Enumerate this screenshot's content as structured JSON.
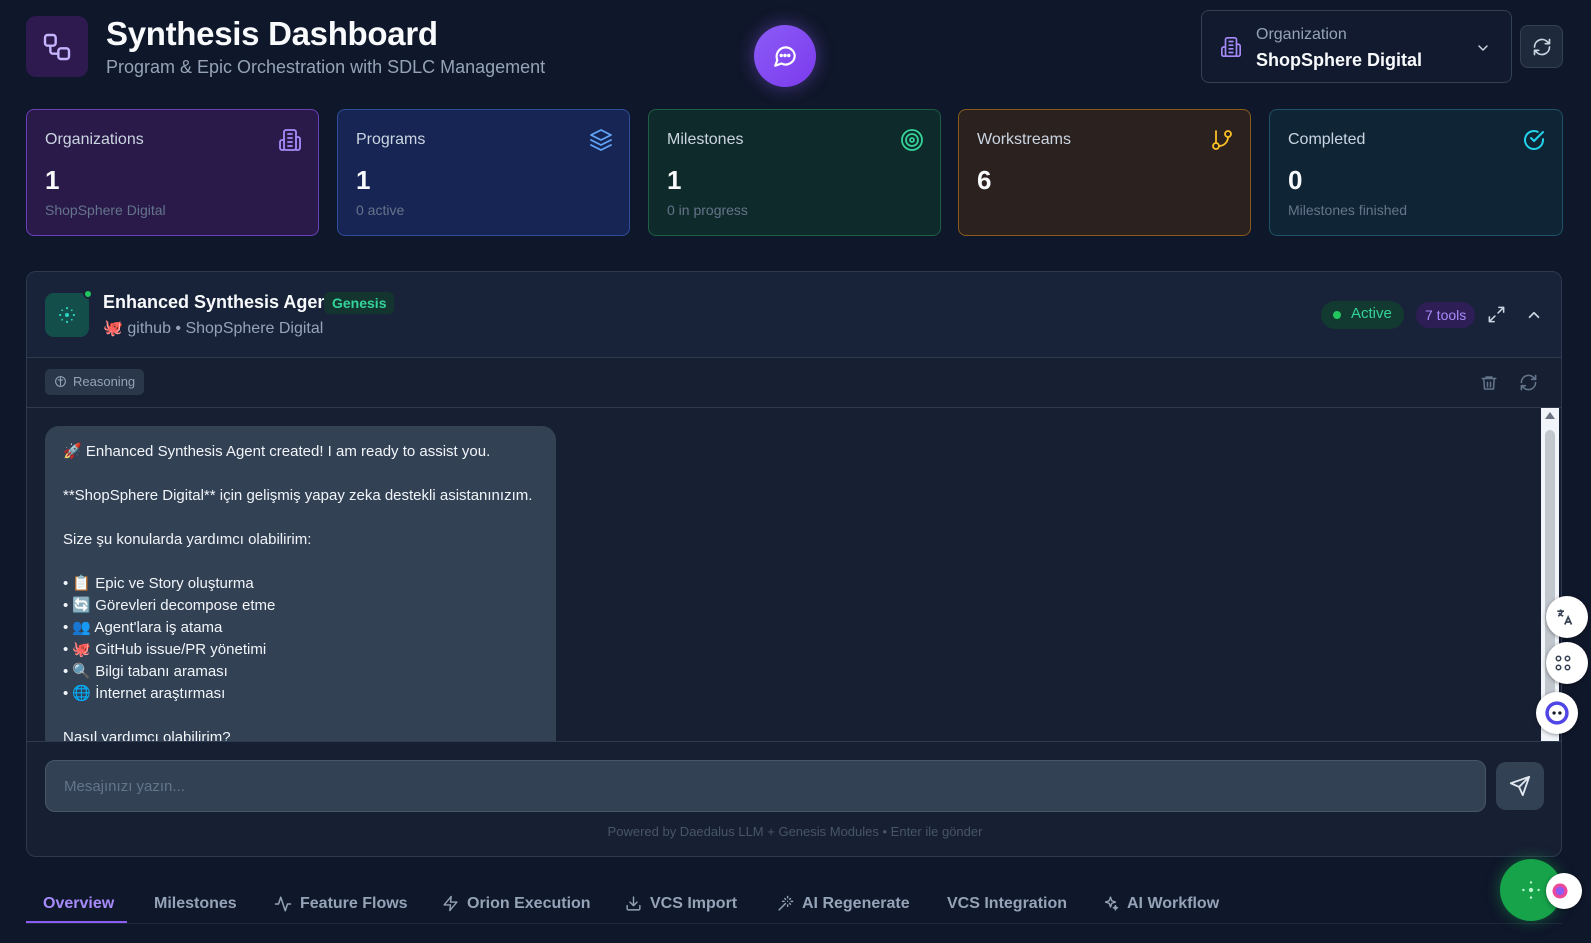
{
  "header": {
    "title": "Synthesis Dashboard",
    "subtitle": "Program & Epic Orchestration with SDLC Management"
  },
  "org_select": {
    "label": "Organization",
    "value": "ShopSphere Digital"
  },
  "stats": [
    {
      "label": "Organizations",
      "value": "1",
      "sub": "ShopSphere Digital",
      "icon": "building-icon"
    },
    {
      "label": "Programs",
      "value": "1",
      "sub": "0 active",
      "icon": "layers-icon"
    },
    {
      "label": "Milestones",
      "value": "1",
      "sub": "0 in progress",
      "icon": "target-icon"
    },
    {
      "label": "Workstreams",
      "value": "6",
      "sub": "",
      "icon": "git-branch-icon"
    },
    {
      "label": "Completed",
      "value": "0",
      "sub": "Milestones finished",
      "icon": "check-circle-icon"
    }
  ],
  "agent": {
    "name": "Enhanced Synthesis Agent",
    "badge": "Genesis",
    "subtitle": "github • ShopSphere Digital",
    "status": "Active",
    "tools": "7 tools",
    "reasoning_label": "Reasoning"
  },
  "message": {
    "lines": [
      "🚀 Enhanced Synthesis Agent created! I am ready to assist you.",
      "",
      "**ShopSphere Digital** için gelişmiş yapay zeka destekli asistanınızım.",
      "",
      "Size şu konularda yardımcı olabilirim:",
      "",
      "• 📋 Epic ve Story oluşturma",
      "• 🔄 Görevleri decompose etme",
      "• 👥 Agent'lara iş atama",
      "• 🐙 GitHub issue/PR yönetimi",
      "• 🔍 Bilgi tabanı araması",
      "• 🌐 İnternet araştırması",
      "",
      "Nasıl yardımcı olabilirim?"
    ]
  },
  "input": {
    "placeholder": "Mesajınızı yazın...",
    "value": ""
  },
  "footer_note": "Powered by Daedalus LLM + Genesis Modules • Enter ile gönder",
  "tabs": [
    {
      "label": "Overview",
      "icon": ""
    },
    {
      "label": "Milestones",
      "icon": ""
    },
    {
      "label": "Feature Flows",
      "icon": "activity-icon"
    },
    {
      "label": "Orion Execution",
      "icon": "zap-icon"
    },
    {
      "label": "VCS Import",
      "icon": "download-icon"
    },
    {
      "label": "AI Regenerate",
      "icon": "wand-icon"
    },
    {
      "label": "VCS Integration",
      "icon": ""
    },
    {
      "label": "AI Workflow",
      "icon": "sparkles-icon"
    }
  ],
  "colors": {
    "background": "#0f172a",
    "accent": "#8b5cf6",
    "success": "#22c55e"
  }
}
